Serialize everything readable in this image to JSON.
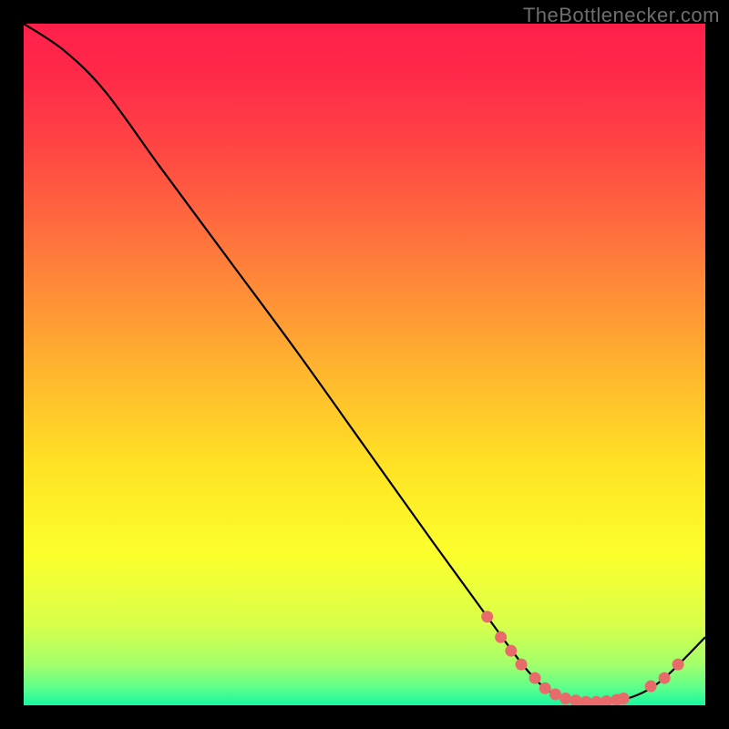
{
  "watermark": "TheBottlenecker.com",
  "chart_data": {
    "type": "line",
    "title": "",
    "xlabel": "",
    "ylabel": "",
    "xlim": [
      0,
      100
    ],
    "ylim": [
      0,
      100
    ],
    "grid": false,
    "legend": false,
    "curve": [
      {
        "x": 0,
        "y": 100
      },
      {
        "x": 6,
        "y": 96
      },
      {
        "x": 12,
        "y": 90
      },
      {
        "x": 20,
        "y": 79
      },
      {
        "x": 30,
        "y": 65.5
      },
      {
        "x": 40,
        "y": 52
      },
      {
        "x": 50,
        "y": 38
      },
      {
        "x": 60,
        "y": 24
      },
      {
        "x": 68,
        "y": 13
      },
      {
        "x": 74,
        "y": 5
      },
      {
        "x": 78,
        "y": 1.5
      },
      {
        "x": 82,
        "y": 0.5
      },
      {
        "x": 86,
        "y": 0.5
      },
      {
        "x": 90,
        "y": 1.5
      },
      {
        "x": 94,
        "y": 4
      },
      {
        "x": 100,
        "y": 10
      }
    ],
    "markers": [
      {
        "x": 68,
        "y": 13
      },
      {
        "x": 70,
        "y": 10
      },
      {
        "x": 71.5,
        "y": 8
      },
      {
        "x": 73,
        "y": 6
      },
      {
        "x": 75,
        "y": 4
      },
      {
        "x": 76.5,
        "y": 2.5
      },
      {
        "x": 78,
        "y": 1.6
      },
      {
        "x": 79.5,
        "y": 1.0
      },
      {
        "x": 81,
        "y": 0.7
      },
      {
        "x": 82.5,
        "y": 0.5
      },
      {
        "x": 84,
        "y": 0.5
      },
      {
        "x": 85.5,
        "y": 0.6
      },
      {
        "x": 87,
        "y": 0.8
      },
      {
        "x": 88,
        "y": 1.0
      },
      {
        "x": 92,
        "y": 2.8
      },
      {
        "x": 94,
        "y": 4.0
      },
      {
        "x": 96,
        "y": 6.0
      }
    ],
    "marker_color": "#e86a6a",
    "curve_color": "#000000",
    "gradient_stops": [
      {
        "offset": 0.0,
        "color": "#ff1f4a"
      },
      {
        "offset": 0.08,
        "color": "#ff2a49"
      },
      {
        "offset": 0.2,
        "color": "#ff4b43"
      },
      {
        "offset": 0.35,
        "color": "#ff7e3b"
      },
      {
        "offset": 0.5,
        "color": "#ffb22f"
      },
      {
        "offset": 0.65,
        "color": "#ffe324"
      },
      {
        "offset": 0.78,
        "color": "#fbff2c"
      },
      {
        "offset": 0.88,
        "color": "#d9ff4a"
      },
      {
        "offset": 0.94,
        "color": "#a3ff6a"
      },
      {
        "offset": 0.975,
        "color": "#5cff8c"
      },
      {
        "offset": 1.0,
        "color": "#17f7a0"
      }
    ]
  }
}
